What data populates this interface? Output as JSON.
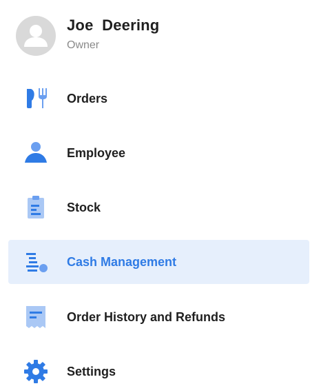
{
  "profile": {
    "name": "Joe  Deering",
    "role": "Owner",
    "avatar_icon": "person-placeholder-icon"
  },
  "menu": {
    "active_item": "Cash Management",
    "items": [
      {
        "label": "Orders",
        "icon": "fork-knife-icon"
      },
      {
        "label": "Employee",
        "icon": "person-icon"
      },
      {
        "label": "Stock",
        "icon": "clipboard-icon"
      },
      {
        "label": "Cash Management",
        "icon": "cash-list-icon"
      },
      {
        "label": "Order History and Refunds",
        "icon": "receipt-icon"
      },
      {
        "label": "Settings",
        "icon": "gear-icon"
      }
    ]
  },
  "colors": {
    "accent": "#2f7be5",
    "active_background": "#e6effc",
    "text": "#1f1f1f",
    "secondary_text": "#8a8a8a",
    "avatar_background": "#d9d9d9"
  }
}
